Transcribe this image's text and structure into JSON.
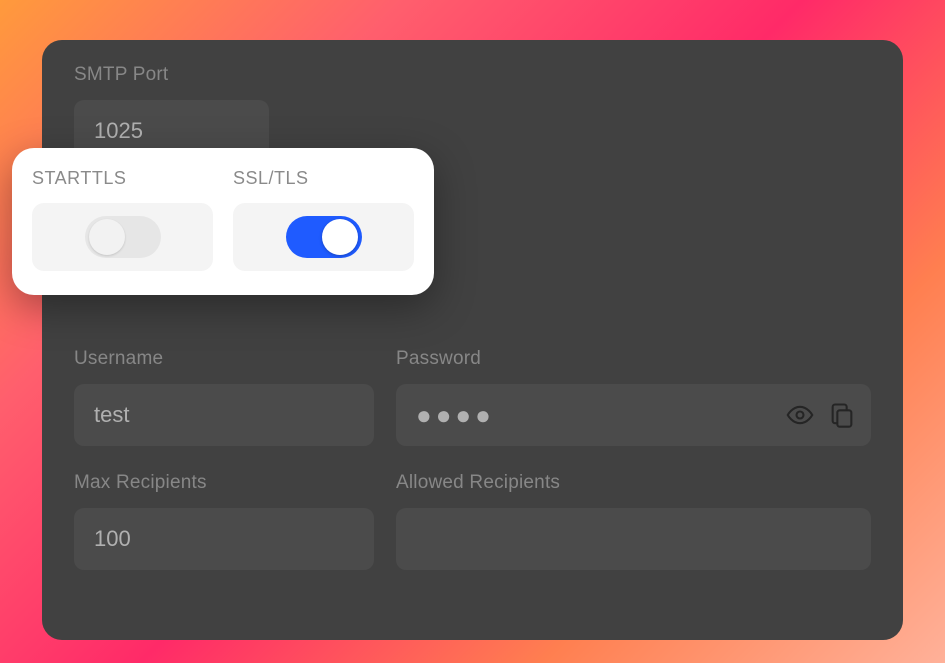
{
  "smtp": {
    "port_label": "SMTP Port",
    "port_value": "1025",
    "starttls_label": "STARTTLS",
    "starttls_on": false,
    "ssltls_label": "SSL/TLS",
    "ssltls_on": true,
    "username_label": "Username",
    "username_value": "test",
    "password_label": "Password",
    "password_masked": "●●●●",
    "max_recipients_label": "Max Recipients",
    "max_recipients_value": "100",
    "allowed_recipients_label": "Allowed Recipients",
    "allowed_recipients_value": ""
  }
}
